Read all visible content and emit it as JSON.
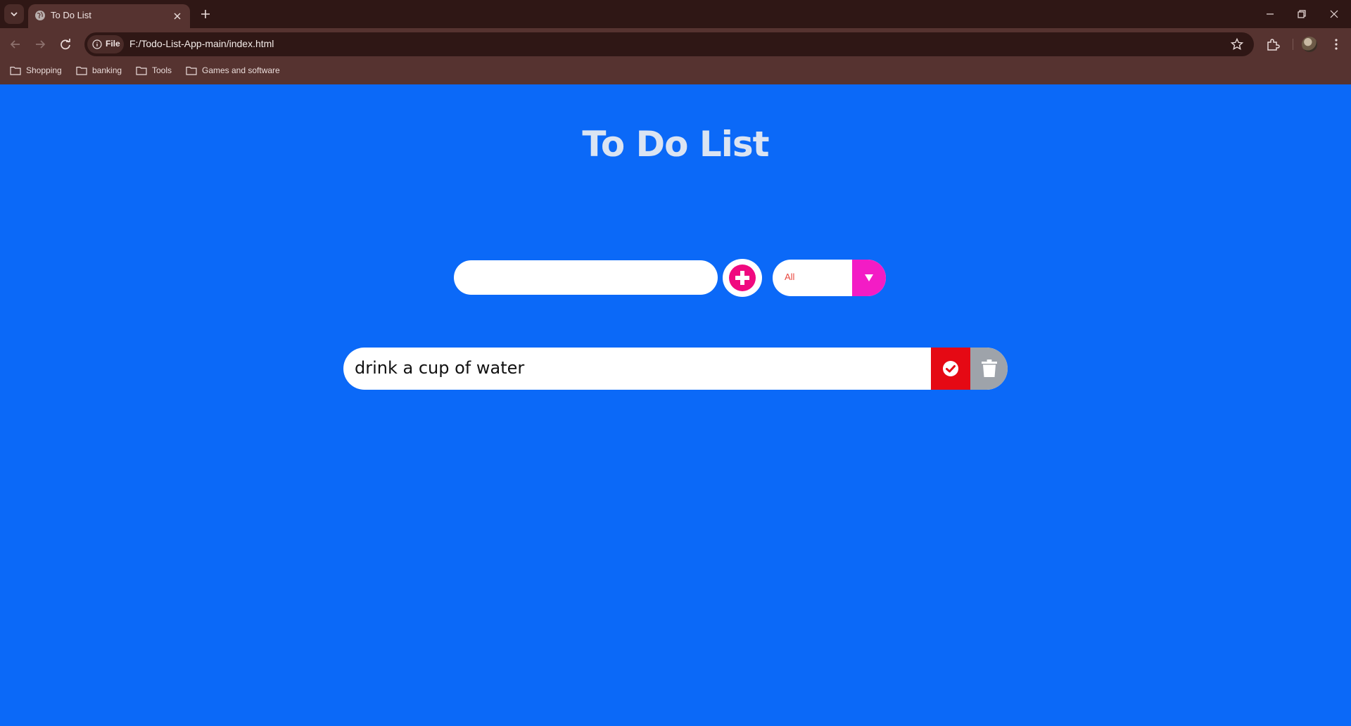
{
  "browser": {
    "tab_title": "To Do List",
    "site_chip_label": "File",
    "url": "F:/Todo-List-App-main/index.html",
    "bookmarks": [
      "Shopping",
      "banking",
      "Tools",
      "Games and software"
    ]
  },
  "app": {
    "title": "To Do List",
    "input_value": "",
    "filter": {
      "selected": "All"
    },
    "todos": [
      {
        "text": "drink a cup of water"
      }
    ]
  },
  "colors": {
    "page_bg": "#0b69f8",
    "add_icon": "#f0097f",
    "filter_accent": "#f31cc5",
    "complete_btn": "#e50914",
    "trash_btn": "#9ea3aa"
  },
  "icons": {
    "add": "plus-circle-icon",
    "filter_arrow": "triangle-down-icon",
    "complete": "check-circle-icon",
    "delete": "trash-icon"
  }
}
